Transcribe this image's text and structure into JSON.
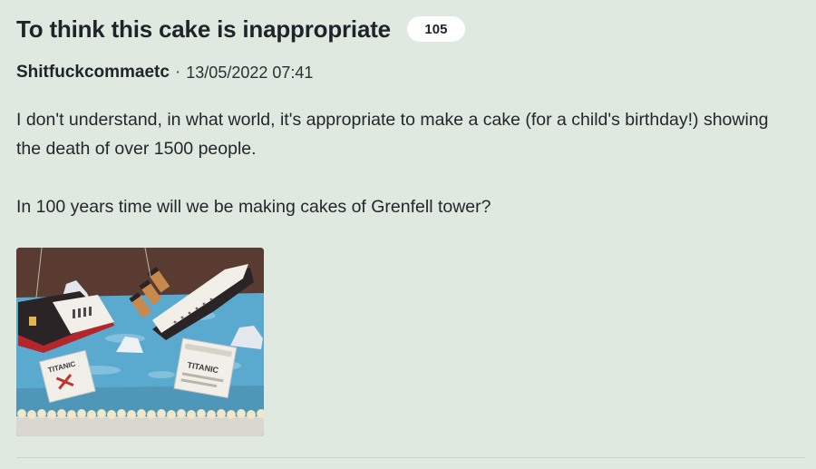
{
  "post": {
    "title": "To think this cake is inappropriate",
    "reply_count": "105",
    "author": "Shitfuckcommaetc",
    "separator": "·",
    "timestamp": "13/05/2022 07:41",
    "body_paragraph_1": "I don't understand, in what world, it's appropriate to make a cake (for a child's birthday!) showing the death of over 1500 people.",
    "body_paragraph_2": "In 100 years time will we be making cakes of Grenfell tower?",
    "image": {
      "card_label_left": "TITANIC",
      "card_label_right": "TITANIC"
    }
  },
  "colors": {
    "page_background": "#dfe9e0",
    "badge_background": "#ffffff",
    "text": "#1f2429"
  }
}
